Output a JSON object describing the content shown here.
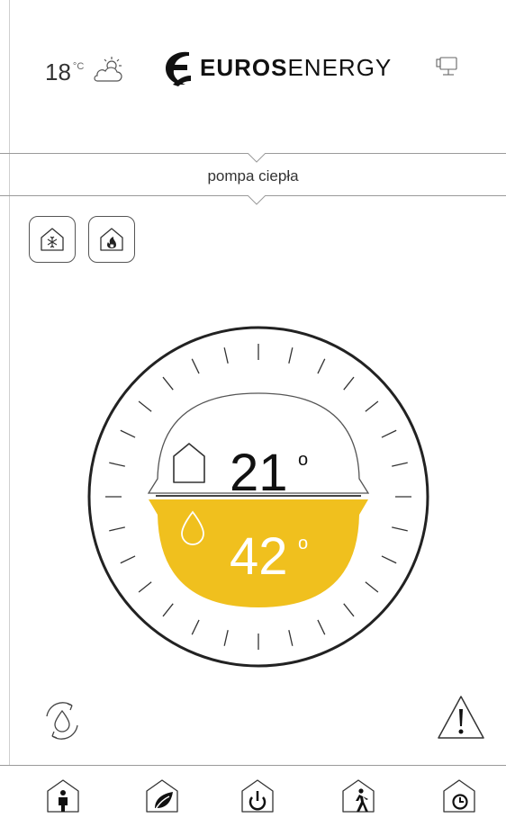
{
  "weather": {
    "temperature": "18",
    "unit": "°C",
    "icon": "partly-cloudy-icon"
  },
  "brand": {
    "bold": "EUROS",
    "regular": "ENERGY"
  },
  "mode": {
    "title": "pompa ciepła"
  },
  "mode_buttons": [
    {
      "name": "cooling-mode",
      "icon": "snowflake-house-icon"
    },
    {
      "name": "heating-mode",
      "icon": "flame-house-icon"
    }
  ],
  "dial": {
    "room_temp": "21",
    "room_unit": "o",
    "water_temp": "42",
    "water_unit": "o",
    "accent_color": "#f0c01e"
  },
  "bottom_nav": [
    {
      "name": "presence",
      "icon": "person-house-icon"
    },
    {
      "name": "eco",
      "icon": "leaf-house-icon"
    },
    {
      "name": "power",
      "icon": "power-house-icon"
    },
    {
      "name": "away",
      "icon": "walking-house-icon"
    },
    {
      "name": "schedule",
      "icon": "clock-house-icon"
    }
  ]
}
